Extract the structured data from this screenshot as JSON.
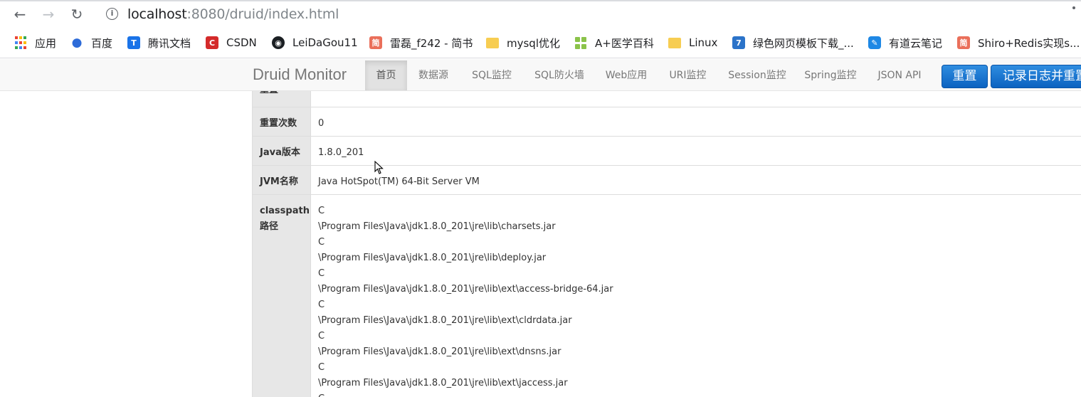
{
  "browser": {
    "url_host": "localhost",
    "url_rest": ":8080/druid/index.html",
    "bookmarks": [
      {
        "label": "应用",
        "icon": "apps-grid-icon"
      },
      {
        "label": "百度",
        "icon": "baidu-paw-icon"
      },
      {
        "label": "腾讯文档",
        "icon": "tencent-docs-icon"
      },
      {
        "label": "CSDN",
        "icon": "csdn-icon",
        "glyph": "C"
      },
      {
        "label": "LeiDaGou11",
        "icon": "github-icon"
      },
      {
        "label": "雷磊_f242 - 简书",
        "icon": "jianshu-icon",
        "glyph": "简"
      },
      {
        "label": "mysql优化",
        "icon": "folder-icon"
      },
      {
        "label": "A+医学百科",
        "icon": "green-grid-icon"
      },
      {
        "label": "Linux",
        "icon": "folder-icon"
      },
      {
        "label": "绿色网页模板下载_...",
        "icon": "lvse-icon",
        "glyph": "7"
      },
      {
        "label": "有道云笔记",
        "icon": "youdao-note-icon"
      },
      {
        "label": "Shiro+Redis实现s...",
        "icon": "jianshu-icon",
        "glyph": "简"
      }
    ]
  },
  "druid": {
    "brand": "Druid Monitor",
    "nav": [
      "首页",
      "数据源",
      "SQL监控",
      "SQL防火墙",
      "Web应用",
      "URI监控",
      "Session监控",
      "Spring监控",
      "JSON API"
    ],
    "active_nav": "首页",
    "btn_reset": "重置",
    "btn_log_reset": "记录日志并重置"
  },
  "table": {
    "partial_top_label": "重置",
    "rows": [
      {
        "label": "重置次数",
        "value": "0"
      },
      {
        "label": "Java版本",
        "value": "1.8.0_201"
      },
      {
        "label": "JVM名称",
        "value": "Java HotSpot(TM) 64-Bit Server VM"
      }
    ],
    "classpath_label_1": "classpath",
    "classpath_label_2": "路径",
    "classpath_lines": [
      "C",
      "\\Program Files\\Java\\jdk1.8.0_201\\jre\\lib\\charsets.jar",
      "C",
      "\\Program Files\\Java\\jdk1.8.0_201\\jre\\lib\\deploy.jar",
      "C",
      "\\Program Files\\Java\\jdk1.8.0_201\\jre\\lib\\ext\\access-bridge-64.jar",
      "C",
      "\\Program Files\\Java\\jdk1.8.0_201\\jre\\lib\\ext\\cldrdata.jar",
      "C",
      "\\Program Files\\Java\\jdk1.8.0_201\\jre\\lib\\ext\\dnsns.jar",
      "C",
      "\\Program Files\\Java\\jdk1.8.0_201\\jre\\lib\\ext\\jaccess.jar",
      "C"
    ]
  },
  "colors": {
    "primary_button": "#0b62c0",
    "header_cell_bg": "#e7e7e7",
    "navbar_bg": "#f8f8f8"
  }
}
